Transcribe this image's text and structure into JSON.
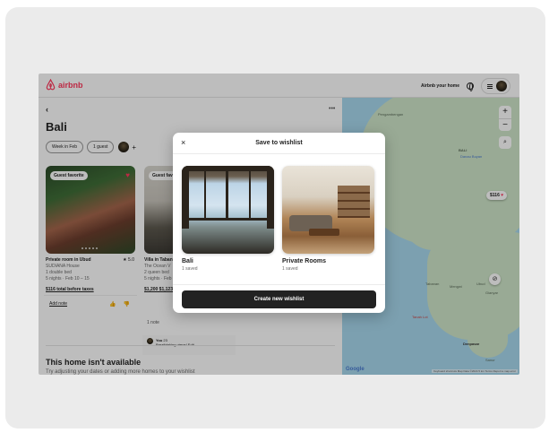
{
  "header": {
    "brand": "airbnb",
    "host_link": "Airbnb your home"
  },
  "list": {
    "title": "Bali",
    "chips": [
      "Week in Feb",
      "1 guest"
    ],
    "chip_plus": "+",
    "cards": [
      {
        "badge": "Guest favorite",
        "title": "Private room in Ubud",
        "rating": "★ 5.0",
        "host": "SUDIANA House",
        "bed": "1 double bed",
        "dates": "5 nights · Feb 10 – 15",
        "price": "$116 total before taxes",
        "add_note": "Add note"
      },
      {
        "badge": "Guest fav",
        "title": "Villa in Taban",
        "host": "The Ocean V",
        "bed": "2 queen bed",
        "dates": "5 nights · Feb",
        "price": "$1,200 $1,123",
        "note_label": "1 note",
        "comment_author": "You",
        "comment_time": "23",
        "comment_text": "Breathtaking views! Edit"
      }
    ],
    "unavailable_title": "This home isn't available",
    "unavailable_sub": "Try adjusting your dates or adding more homes to your wishlist"
  },
  "map": {
    "zoom_in": "+",
    "zoom_out": "−",
    "price_pin": "$116",
    "labels": [
      "Pengambengan",
      "BALI",
      "Danau Buyan",
      "Tabanan",
      "Mengwi",
      "Ubud",
      "Gianyar",
      "Denpasar",
      "Tanah Lot",
      "Sanur"
    ],
    "google": "Google",
    "attribution": "Keyboard shortcuts   Map Data ©2024   5 km   Terms   Report a map error"
  },
  "modal": {
    "title": "Save to wishlist",
    "close": "×",
    "wishlists": [
      {
        "name": "Bali",
        "saved": "1 saved"
      },
      {
        "name": "Private Rooms",
        "saved": "1 saved"
      }
    ],
    "create_button": "Create new wishlist"
  }
}
